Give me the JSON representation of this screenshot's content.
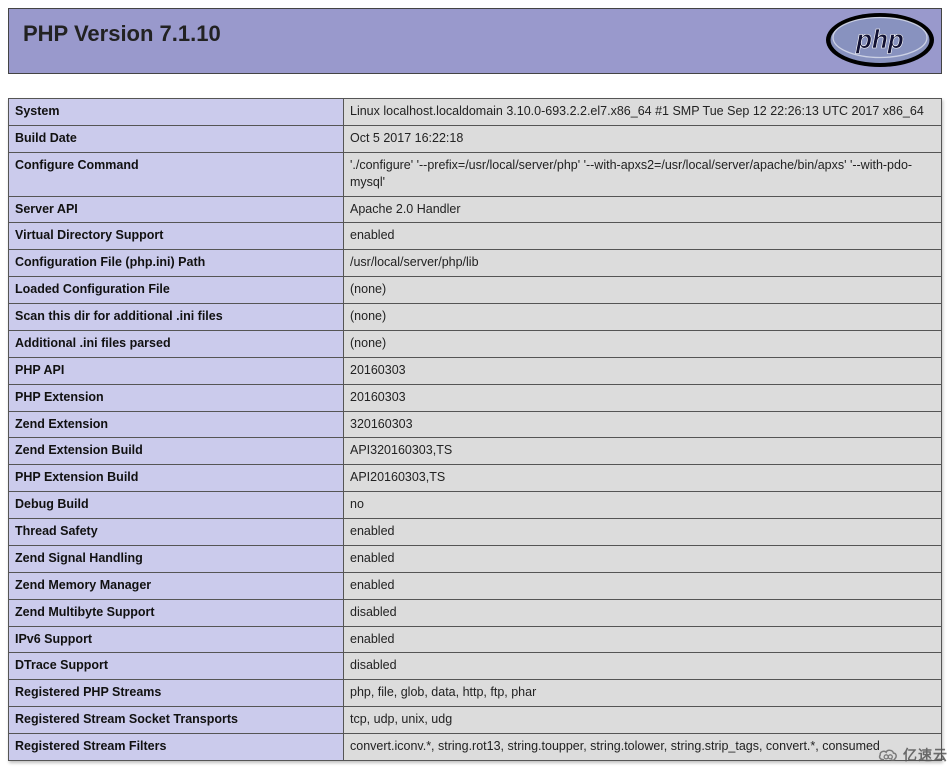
{
  "header": {
    "title": "PHP Version 7.1.10",
    "logo_text": "php"
  },
  "rows": [
    {
      "key": "System",
      "value": "Linux localhost.localdomain 3.10.0-693.2.2.el7.x86_64 #1 SMP Tue Sep 12 22:26:13 UTC 2017 x86_64"
    },
    {
      "key": "Build Date",
      "value": "Oct 5 2017 16:22:18"
    },
    {
      "key": "Configure Command",
      "value": "'./configure' '--prefix=/usr/local/server/php' '--with-apxs2=/usr/local/server/apache/bin/apxs' '--with-pdo-mysql'"
    },
    {
      "key": "Server API",
      "value": "Apache 2.0 Handler"
    },
    {
      "key": "Virtual Directory Support",
      "value": "enabled"
    },
    {
      "key": "Configuration File (php.ini) Path",
      "value": "/usr/local/server/php/lib"
    },
    {
      "key": "Loaded Configuration File",
      "value": "(none)"
    },
    {
      "key": "Scan this dir for additional .ini files",
      "value": "(none)"
    },
    {
      "key": "Additional .ini files parsed",
      "value": "(none)"
    },
    {
      "key": "PHP API",
      "value": "20160303"
    },
    {
      "key": "PHP Extension",
      "value": "20160303"
    },
    {
      "key": "Zend Extension",
      "value": "320160303"
    },
    {
      "key": "Zend Extension Build",
      "value": "API320160303,TS"
    },
    {
      "key": "PHP Extension Build",
      "value": "API20160303,TS"
    },
    {
      "key": "Debug Build",
      "value": "no"
    },
    {
      "key": "Thread Safety",
      "value": "enabled"
    },
    {
      "key": "Zend Signal Handling",
      "value": "enabled"
    },
    {
      "key": "Zend Memory Manager",
      "value": "enabled"
    },
    {
      "key": "Zend Multibyte Support",
      "value": "disabled"
    },
    {
      "key": "IPv6 Support",
      "value": "enabled"
    },
    {
      "key": "DTrace Support",
      "value": "disabled"
    },
    {
      "key": "Registered PHP Streams",
      "value": "php, file, glob, data, http, ftp, phar"
    },
    {
      "key": "Registered Stream Socket Transports",
      "value": "tcp, udp, unix, udg"
    },
    {
      "key": "Registered Stream Filters",
      "value": "convert.iconv.*, string.rot13, string.toupper, string.tolower, string.strip_tags, convert.*, consumed"
    }
  ],
  "watermark": {
    "text": "亿速云"
  }
}
